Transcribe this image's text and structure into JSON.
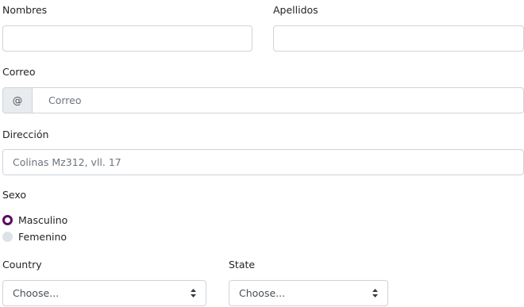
{
  "fields": {
    "nombres_label": "Nombres",
    "apellidos_label": "Apellidos",
    "correo_label": "Correo",
    "correo_prefix": "@",
    "correo_placeholder": "Correo",
    "direccion_label": "Dirección",
    "direccion_placeholder": "Colinas Mz312, vll. 17",
    "sexo_label": "Sexo",
    "sexo_options": [
      {
        "label": "Masculino",
        "checked": true
      },
      {
        "label": "Femenino",
        "checked": false
      }
    ],
    "country_label": "Country",
    "country_value": "Choose...",
    "state_label": "State",
    "state_value": "Choose..."
  },
  "colors": {
    "radio_checked": "#5a0b5e",
    "border": "#ced4da",
    "prepend_bg": "#e9ecef"
  }
}
